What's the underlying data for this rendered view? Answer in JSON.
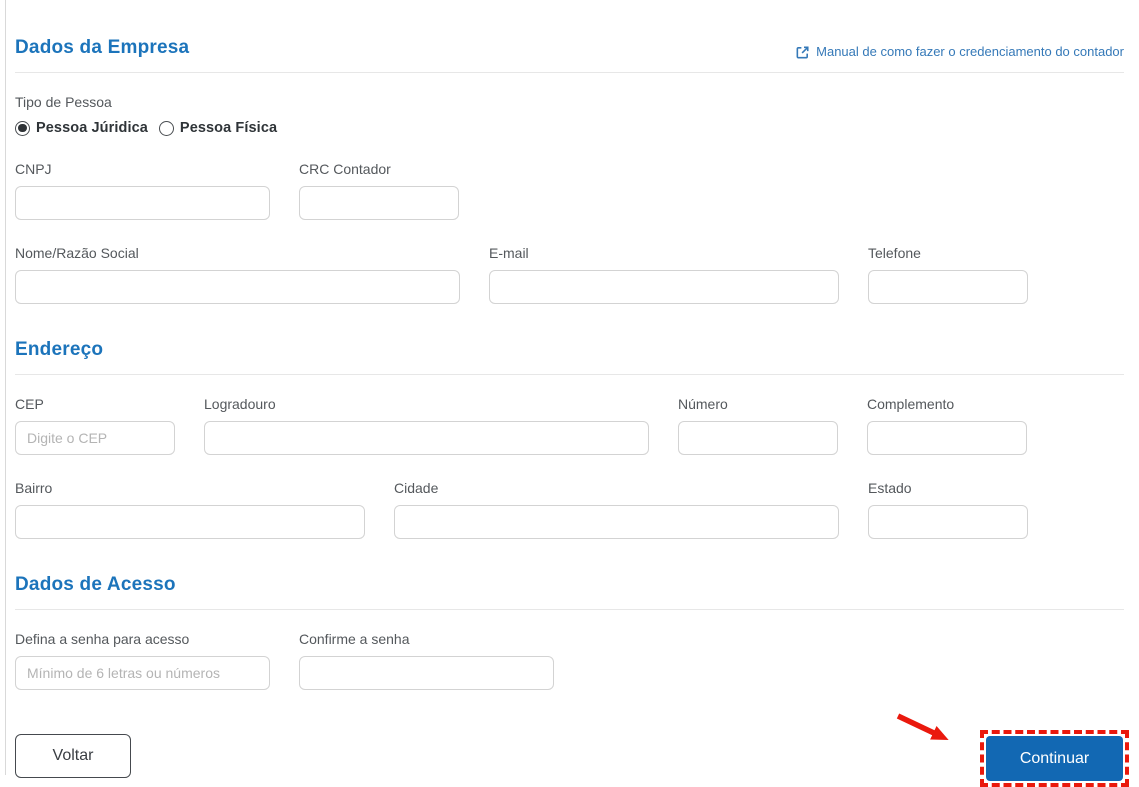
{
  "colors": {
    "title_blue": "#1c74bb",
    "link_blue": "#3579b8",
    "button_blue": "#1268b3",
    "annotation_red": "#ea190d"
  },
  "sections": {
    "company": {
      "title": "Dados da Empresa",
      "manual_link_label": "Manual de como fazer o credenciamento do contador",
      "manual_link_icon": "external-link-icon",
      "tipo_pessoa": {
        "label": "Tipo de Pessoa",
        "options": [
          {
            "label": "Pessoa Júridica",
            "selected": true
          },
          {
            "label": "Pessoa Física",
            "selected": false
          }
        ]
      },
      "fields": {
        "cnpj": {
          "label": "CNPJ",
          "value": "",
          "placeholder": ""
        },
        "crc": {
          "label": "CRC Contador",
          "value": "",
          "placeholder": ""
        },
        "nome": {
          "label": "Nome/Razão Social",
          "value": "",
          "placeholder": ""
        },
        "email": {
          "label": "E-mail",
          "value": "",
          "placeholder": ""
        },
        "telefone": {
          "label": "Telefone",
          "value": "",
          "placeholder": ""
        }
      }
    },
    "endereco": {
      "title": "Endereço",
      "fields": {
        "cep": {
          "label": "CEP",
          "value": "",
          "placeholder": "Digite o CEP"
        },
        "logradouro": {
          "label": "Logradouro",
          "value": "",
          "placeholder": ""
        },
        "numero": {
          "label": "Número",
          "value": "",
          "placeholder": ""
        },
        "complemento": {
          "label": "Complemento",
          "value": "",
          "placeholder": ""
        },
        "bairro": {
          "label": "Bairro",
          "value": "",
          "placeholder": ""
        },
        "cidade": {
          "label": "Cidade",
          "value": "",
          "placeholder": ""
        },
        "estado": {
          "label": "Estado",
          "value": "",
          "placeholder": ""
        }
      }
    },
    "acesso": {
      "title": "Dados de Acesso",
      "fields": {
        "senha": {
          "label": "Defina a senha para acesso",
          "value": "",
          "placeholder": "Mínimo de 6 letras ou números"
        },
        "confirmar": {
          "label": "Confirme a senha",
          "value": "",
          "placeholder": ""
        }
      }
    }
  },
  "buttons": {
    "voltar": "Voltar",
    "continuar": "Continuar"
  },
  "annotations": {
    "arrow_icon": "red-arrow-icon",
    "highlight": "dashed-red-highlight"
  }
}
